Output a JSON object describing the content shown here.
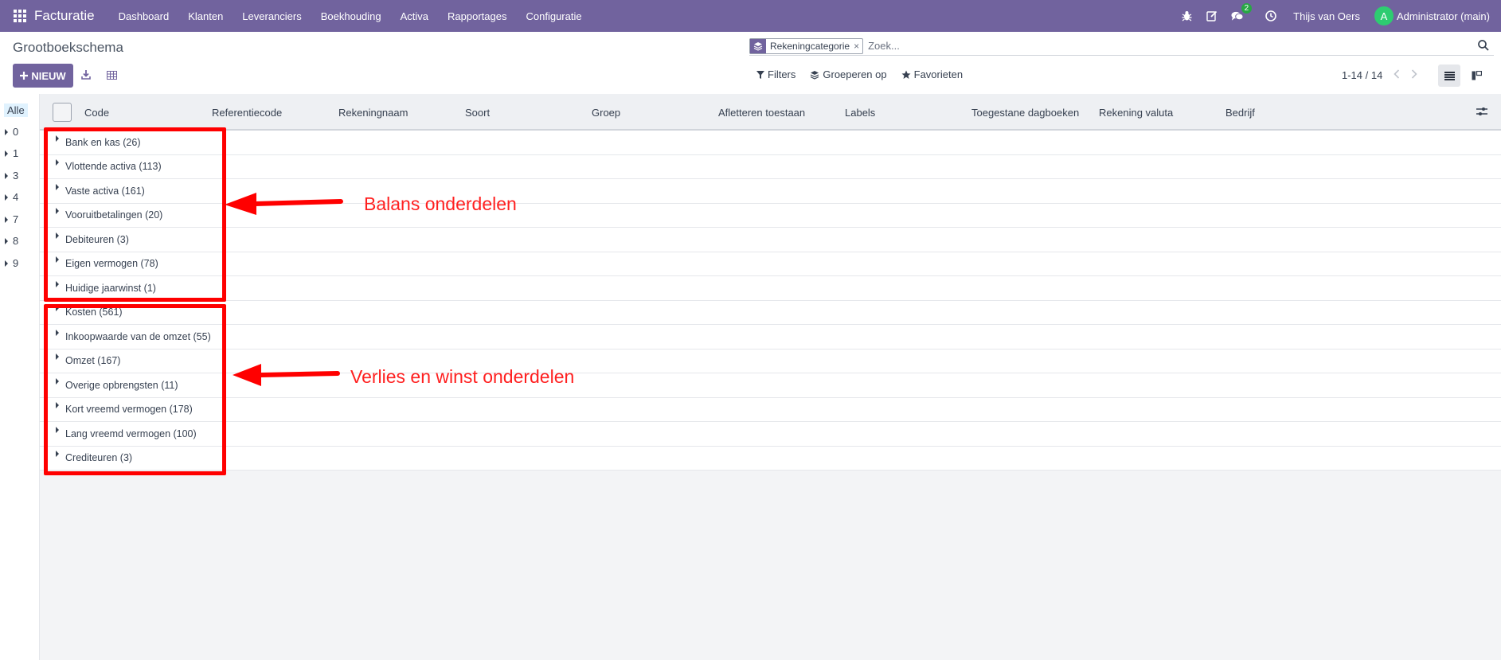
{
  "navbar": {
    "app_name": "Facturatie",
    "menu": [
      "Dashboard",
      "Klanten",
      "Leveranciers",
      "Boekhouding",
      "Activa",
      "Rapportages",
      "Configuratie"
    ],
    "messages_badge": "2",
    "company_user": "Thijs van Oers",
    "avatar_letter": "A",
    "admin": "Administrator (main)",
    "color": "#71639e"
  },
  "control_panel": {
    "title": "Grootboekschema",
    "new_button": "NIEUW",
    "search_facet": "Rekeningcategorie",
    "search_placeholder": "Zoek...",
    "filters": "Filters",
    "group_by": "Groeperen op",
    "favorites": "Favorieten",
    "pager": "1-14 / 14"
  },
  "sidepanel": {
    "items": [
      "Alle",
      "0",
      "1",
      "3",
      "4",
      "7",
      "8",
      "9"
    ]
  },
  "table": {
    "columns": [
      "Code",
      "Referentiecode",
      "Rekeningnaam",
      "Soort",
      "Groep",
      "Afletteren toestaan",
      "Labels",
      "Toegestane dagboeken",
      "Rekening valuta",
      "Bedrijf"
    ],
    "groups": [
      "Bank en kas (26)",
      "Vlottende activa (113)",
      "Vaste activa (161)",
      "Vooruitbetalingen (20)",
      "Debiteuren (3)",
      "Eigen vermogen (78)",
      "Huidige jaarwinst (1)",
      "Kosten (561)",
      "Inkoopwaarde van de omzet (55)",
      "Omzet (167)",
      "Overige opbrengsten (11)",
      "Kort vreemd vermogen (178)",
      "Lang vreemd vermogen (100)",
      "Crediteuren (3)"
    ]
  },
  "annotations": {
    "balance": "Balans onderdelen",
    "pnl": "Verlies en winst onderdelen",
    "color": "#ff0000"
  }
}
